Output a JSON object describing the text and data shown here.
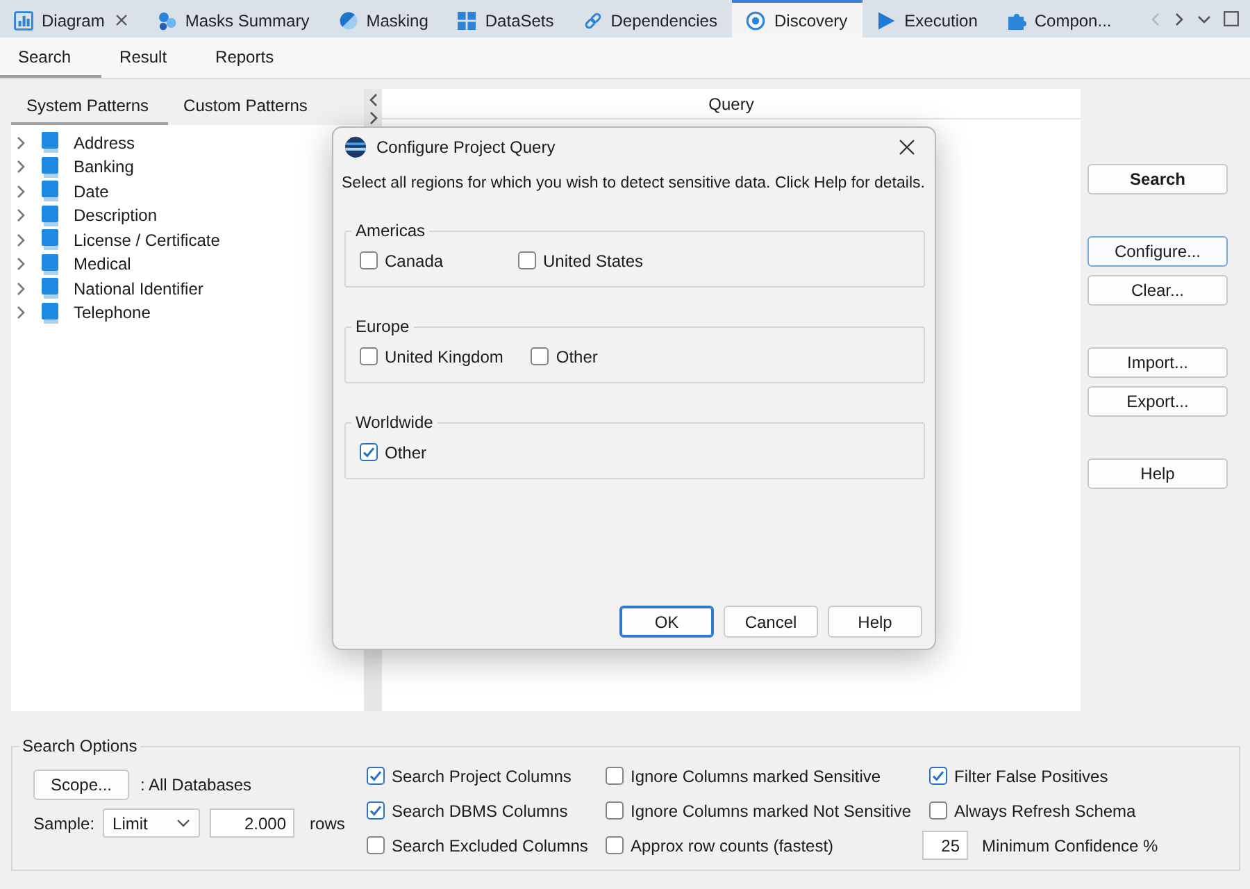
{
  "tabs": [
    {
      "kind": "diagram",
      "label": "Diagram",
      "closable": true,
      "selected": false
    },
    {
      "kind": "masks",
      "label": "Masks Summary",
      "closable": false,
      "selected": false
    },
    {
      "kind": "masking",
      "label": "Masking",
      "closable": false,
      "selected": false
    },
    {
      "kind": "datasets",
      "label": "DataSets",
      "closable": false,
      "selected": false
    },
    {
      "kind": "dependencies",
      "label": "Dependencies",
      "closable": false,
      "selected": false
    },
    {
      "kind": "discovery",
      "label": "Discovery",
      "closable": false,
      "selected": true
    },
    {
      "kind": "execution",
      "label": "Execution",
      "closable": false,
      "selected": false
    },
    {
      "kind": "components",
      "label": "Compon...",
      "closable": false,
      "selected": false
    }
  ],
  "tab_strip_nav": {
    "previous_disabled": true,
    "next_disabled": false
  },
  "sub_tabs": [
    {
      "label": "Search",
      "selected": true
    },
    {
      "label": "Result",
      "selected": false
    },
    {
      "label": "Reports",
      "selected": false
    }
  ],
  "patterns": {
    "tabs": [
      {
        "label": "System Patterns",
        "selected": true
      },
      {
        "label": "Custom Patterns",
        "selected": false
      }
    ],
    "items": [
      {
        "label": "Address",
        "expanded": false
      },
      {
        "label": "Banking",
        "expanded": false
      },
      {
        "label": "Date",
        "expanded": false
      },
      {
        "label": "Description",
        "expanded": false
      },
      {
        "label": "License / Certificate",
        "expanded": false
      },
      {
        "label": "Medical",
        "expanded": false
      },
      {
        "label": "National Identifier",
        "expanded": false
      },
      {
        "label": "Telephone",
        "expanded": false
      }
    ]
  },
  "query": {
    "title": "Query"
  },
  "actions": [
    {
      "buttons": [
        {
          "label": "Search",
          "primary": true,
          "focused": false
        }
      ]
    },
    {
      "buttons": [
        {
          "label": "Configure...",
          "primary": false,
          "focused": true
        },
        {
          "label": "Clear...",
          "primary": false,
          "focused": false
        }
      ]
    },
    {
      "buttons": [
        {
          "label": "Import...",
          "primary": false,
          "focused": false
        },
        {
          "label": "Export...",
          "primary": false,
          "focused": false
        }
      ]
    },
    {
      "buttons": [
        {
          "label": "Help",
          "primary": false,
          "focused": false
        }
      ]
    }
  ],
  "search_options": {
    "title": "Search Options",
    "scope_button": "Scope...",
    "scope_value": ": All Databases",
    "sample_label": "Sample:",
    "sample_mode": "Limit",
    "sample_rows": "2.000",
    "rows_label": "rows",
    "columns": [
      [
        {
          "kind": "checkbox",
          "label": "Search Project Columns",
          "checked": true
        },
        {
          "kind": "checkbox",
          "label": "Search DBMS Columns",
          "checked": true
        },
        {
          "kind": "checkbox",
          "label": "Search Excluded Columns",
          "checked": false
        }
      ],
      [
        {
          "kind": "checkbox",
          "label": "Ignore Columns marked Sensitive",
          "checked": false
        },
        {
          "kind": "checkbox",
          "label": "Ignore Columns marked Not Sensitive",
          "checked": false
        },
        {
          "kind": "checkbox",
          "label": "Approx row counts (fastest)",
          "checked": false
        }
      ],
      [
        {
          "kind": "checkbox",
          "label": "Filter False Positives",
          "checked": true
        },
        {
          "kind": "checkbox",
          "label": "Always Refresh Schema",
          "checked": false
        },
        {
          "kind": "number",
          "value": "25",
          "label": "Minimum Confidence %"
        }
      ]
    ]
  },
  "dialog": {
    "title": "Configure Project Query",
    "message": "Select all regions for which you wish to detect sensitive data. Click Help for details.",
    "groups": [
      {
        "title": "Americas",
        "options": [
          {
            "label": "Canada",
            "checked": false
          },
          {
            "label": "United States",
            "checked": false
          }
        ]
      },
      {
        "title": "Europe",
        "options": [
          {
            "label": "United Kingdom",
            "checked": false
          },
          {
            "label": "Other",
            "checked": false
          }
        ]
      },
      {
        "title": "Worldwide",
        "options": [
          {
            "label": "Other",
            "checked": true
          }
        ]
      }
    ],
    "buttons": [
      {
        "label": "OK",
        "default": true
      },
      {
        "label": "Cancel",
        "default": false
      },
      {
        "label": "Help",
        "default": false
      }
    ]
  }
}
